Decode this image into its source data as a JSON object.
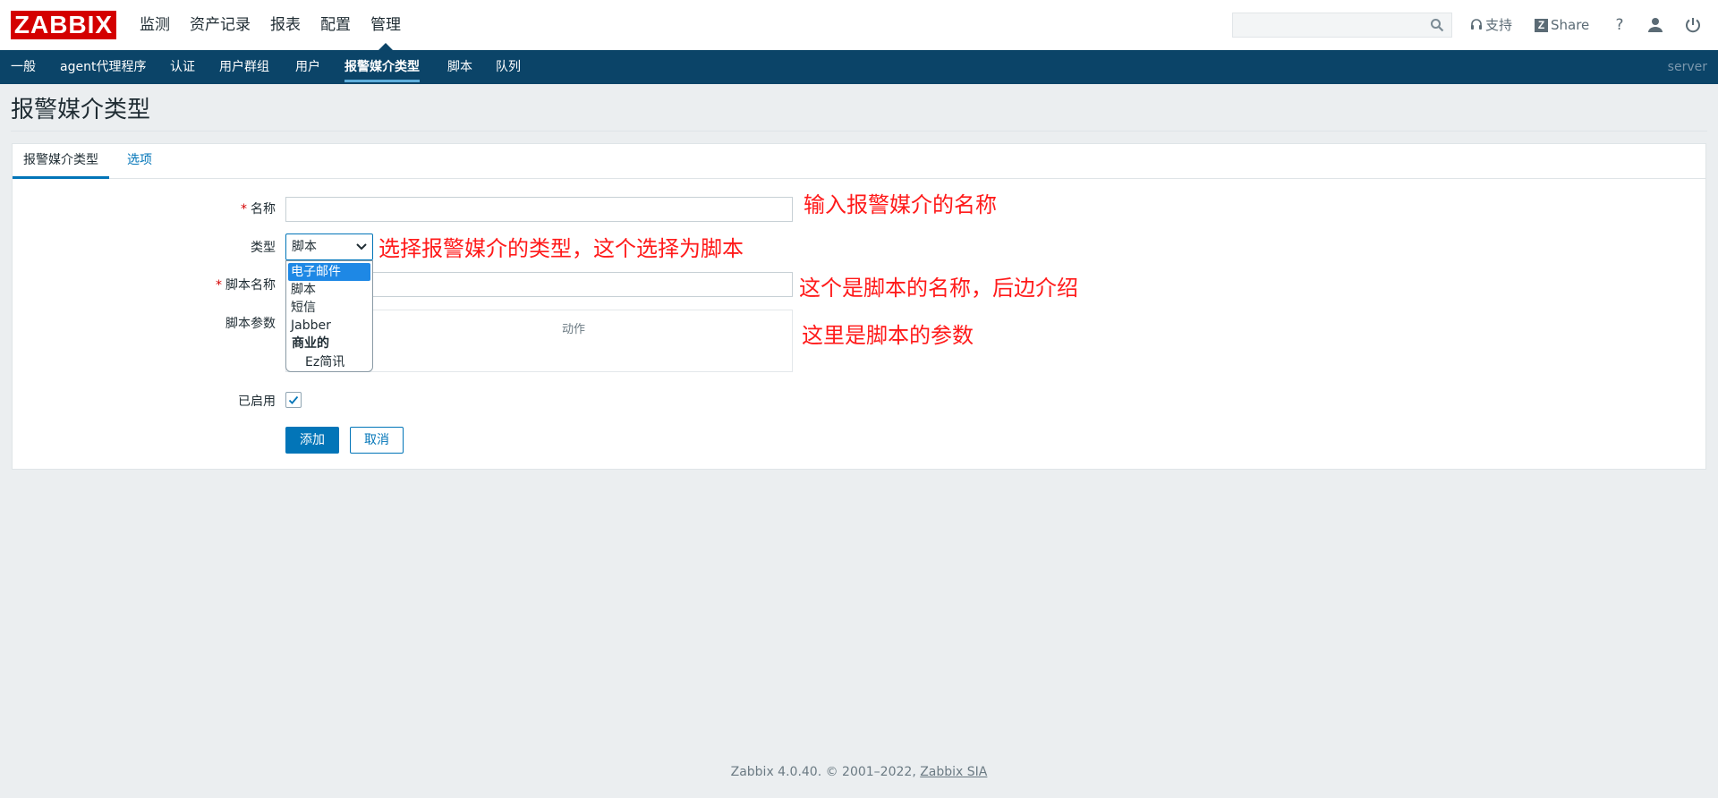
{
  "header": {
    "logo": "ZABBIX",
    "nav": [
      "监测",
      "资产记录",
      "报表",
      "配置",
      "管理"
    ],
    "active_nav": "管理",
    "search_placeholder": "",
    "support_label": "支持",
    "share_label": "Share",
    "help_label": "?"
  },
  "subnav": {
    "items": [
      "一般",
      "agent代理程序",
      "认证",
      "用户群组",
      "用户",
      "报警媒介类型",
      "脚本",
      "队列"
    ],
    "active": "报警媒介类型",
    "server_label": "server"
  },
  "page": {
    "title": "报警媒介类型"
  },
  "tabs": [
    "报警媒介类型",
    "选项"
  ],
  "form": {
    "name_label": "名称",
    "name_value": "",
    "type_label": "类型",
    "type_value": "脚本",
    "type_options": [
      "电子邮件",
      "脚本",
      "短信",
      "Jabber"
    ],
    "type_group_label": "商业的",
    "type_group_options": [
      "Ez简讯"
    ],
    "highlighted_option": "电子邮件",
    "script_name_label": "脚本名称",
    "script_name_value": "",
    "script_params_label": "脚本参数",
    "params_header": "动作",
    "enabled_label": "已启用",
    "enabled": true,
    "add_label": "添加",
    "cancel_label": "取消"
  },
  "annotations": {
    "name": "输入报警媒介的名称",
    "type": "选择报警媒介的类型，这个选择为脚本",
    "script_name": "这个是脚本的名称，后边介绍",
    "params": "这里是脚本的参数"
  },
  "footer": {
    "text": "Zabbix 4.0.40. © 2001–2022, ",
    "link": "Zabbix SIA"
  },
  "colors": {
    "brand_red": "#d40000",
    "subnav_bg": "#0b4468",
    "primary_blue": "#0275b8",
    "annotation_red": "#ff1a1a"
  }
}
